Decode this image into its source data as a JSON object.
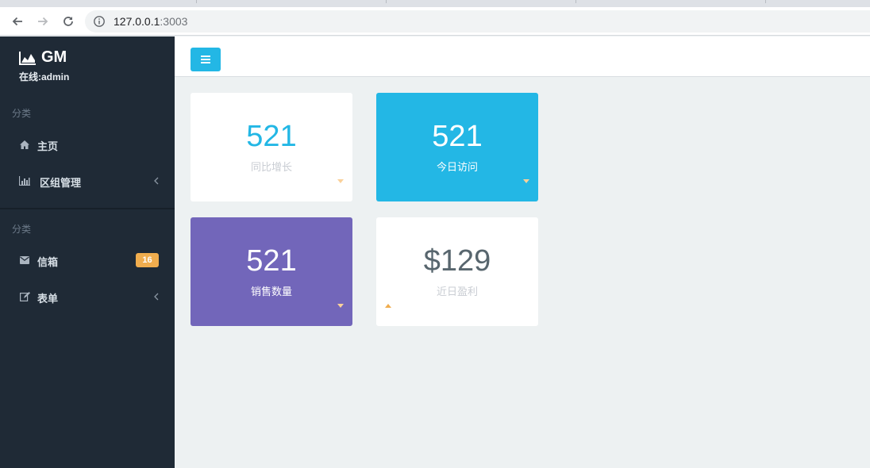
{
  "browser": {
    "url_host": "127.0.0.1",
    "url_port": ":3003"
  },
  "sidebar": {
    "brand": "GM",
    "online": "在线:admin",
    "section1_label": "分类",
    "section2_label": "分类",
    "items": [
      {
        "label": "主页",
        "icon": "home-icon"
      },
      {
        "label": "区组管理",
        "icon": "bar-chart-icon"
      },
      {
        "label": "信箱",
        "icon": "envelope-icon",
        "badge": "16"
      },
      {
        "label": "表单",
        "icon": "edit-icon"
      }
    ]
  },
  "cards": [
    {
      "value": "521",
      "label": "同比增长",
      "trend": "down"
    },
    {
      "value": "521",
      "label": "今日访问",
      "trend": "down"
    },
    {
      "value": "521",
      "label": "销售数量",
      "trend": "down"
    },
    {
      "value": "$129",
      "label": "近日盈利",
      "trend": "up"
    }
  ],
  "colors": {
    "sidebar_bg": "#1f2a36",
    "accent_blue": "#23b7e5",
    "purple": "#7266ba",
    "badge_orange": "#f0ad4e",
    "content_bg": "#edf1f2"
  }
}
